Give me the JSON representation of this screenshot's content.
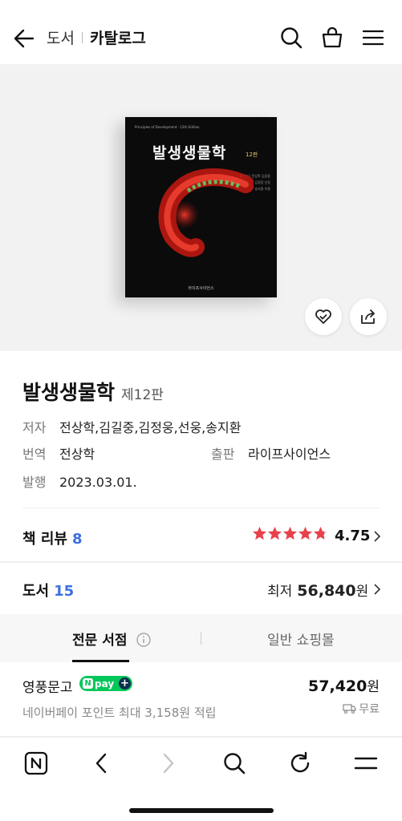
{
  "header": {
    "breadcrumb_root": "도서",
    "breadcrumb_current": "카탈로그",
    "icons": [
      "back-arrow-icon",
      "search-icon",
      "cart-icon",
      "menu-icon"
    ]
  },
  "cover": {
    "title": "발생생물학",
    "edition": "12판",
    "small_header": "Principles of Development · 12th Edition",
    "authors": [
      "옮긴이 | 전상학 김길중",
      "김정웅 선웅",
      "송지환 이종"
    ],
    "publisher": "라이프사이언스"
  },
  "book": {
    "title": "발생생물학",
    "edition": "제12판",
    "author_label": "저자",
    "authors": "전상학,김길중,김정웅,선웅,송지환",
    "translator_label": "번역",
    "translator": "전상학",
    "publisher_label": "출판",
    "publisher": "라이프사이언스",
    "date_label": "발행",
    "date": "2023.03.01."
  },
  "review": {
    "label": "책 리뷰",
    "count": "8",
    "rating": "4.75",
    "stars": 4.75,
    "star_color": "#e8414b"
  },
  "stores": {
    "label": "도서",
    "count": "15",
    "lowest_label": "최저",
    "lowest_price": "56,840",
    "currency": "원"
  },
  "tabs": {
    "professional": "전문 서점",
    "general": "일반 쇼핑몰",
    "active": "professional"
  },
  "seller": {
    "name": "영풍문고",
    "npay": "pay",
    "price": "57,420",
    "currency": "원",
    "point_note": "네이버페이 포인트 최대 3,158원 적립",
    "shipping": "무료"
  },
  "colors": {
    "accent_blue": "#3d6fe0",
    "npay_green": "#04c75a"
  },
  "bottom_bar": {
    "icons": [
      "naver-n-icon",
      "back-icon",
      "forward-icon",
      "search-icon",
      "reload-icon",
      "menu-icon"
    ]
  }
}
